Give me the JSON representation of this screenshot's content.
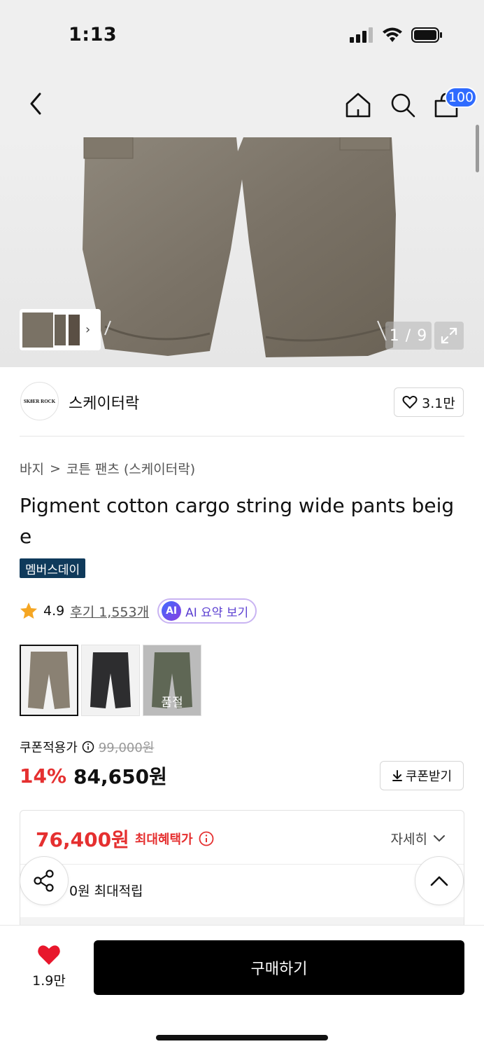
{
  "status_bar": {
    "time": "1:13"
  },
  "header": {
    "cart_count": "100"
  },
  "gallery": {
    "counter": "1 / 9"
  },
  "brand": {
    "logo_text": "SK8ER ROCK",
    "name": "스케이터락",
    "likes": "3.1만"
  },
  "breadcrumb": {
    "category": "바지",
    "separator": ">",
    "subcategory": "코튼 팬츠 (스케이터락)"
  },
  "product": {
    "title": "Pigment cotton cargo string wide pants beige",
    "badge": "멤버스데이",
    "rating": "4.9",
    "reviews": "후기 1,553개",
    "ai_badge": "AI",
    "ai_summary": "AI 요약 보기"
  },
  "swatches": [
    {
      "color": "#8a8173",
      "state": ""
    },
    {
      "color": "#2d2d2f",
      "state": ""
    },
    {
      "color": "#4b5a3a",
      "state": "품절"
    }
  ],
  "price": {
    "coupon_label": "쿠폰적용가",
    "original": "99,000원",
    "discount": "14%",
    "final": "84,650원",
    "coupon_button": "쿠폰받기"
  },
  "benefit": {
    "max_price": "76,400원",
    "max_label": "최대혜택가",
    "detail": "자세히",
    "points": "0원 최대적립"
  },
  "bottom": {
    "wish_count": "1.9만",
    "buy_label": "구매하기"
  },
  "colors": {
    "accent_red": "#e53030",
    "badge_blue": "#2f6bff",
    "member_badge": "#0f3a5b"
  }
}
